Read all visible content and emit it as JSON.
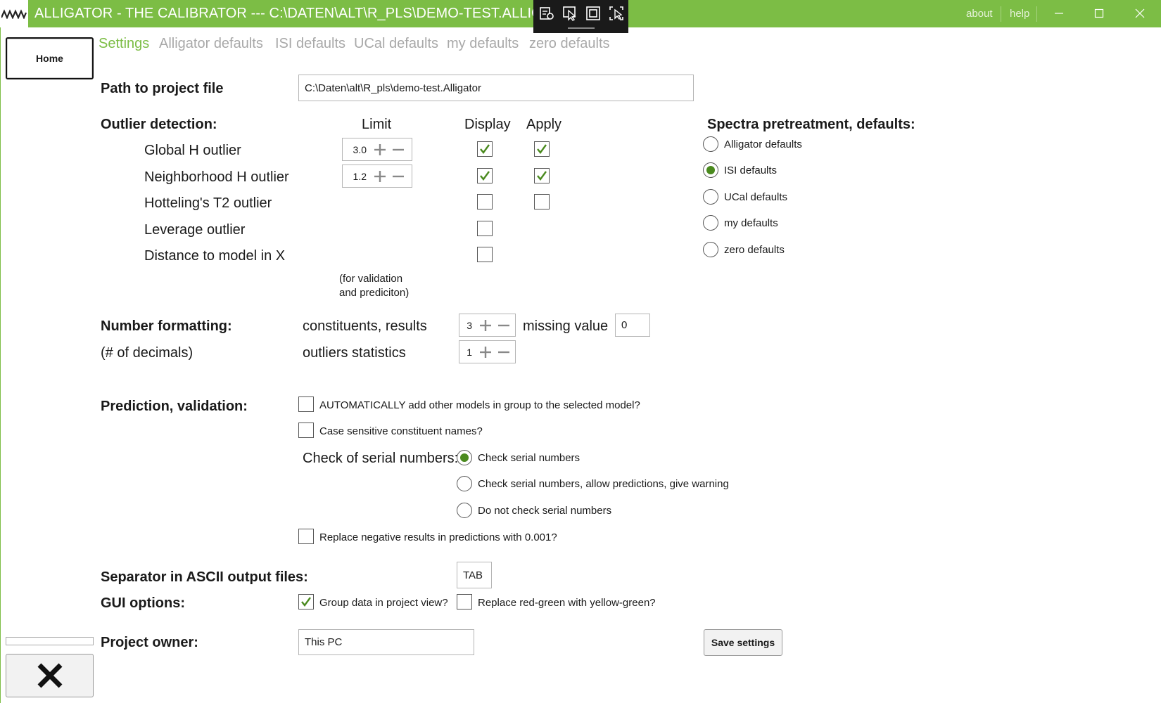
{
  "window": {
    "title": "ALLIGATOR - THE CALIBRATOR --- C:\\DATEN\\ALT\\R_PLS\\DEMO-TEST.ALLIGATOR",
    "about": "about",
    "help": "help",
    "accent": "#7cbd45"
  },
  "nav": {
    "home": "Home",
    "tabs": [
      "Settings",
      "Alligator defaults",
      "ISI defaults",
      "UCal defaults",
      "my defaults",
      "zero defaults"
    ],
    "active_tab": "Settings"
  },
  "project": {
    "path_label": "Path to project file",
    "path_value": "C:\\Daten\\alt\\R_pls\\demo-test.Alligator"
  },
  "outliers": {
    "label": "Outlier detection:",
    "col_limit": "Limit",
    "col_display": "Display",
    "col_apply": "Apply",
    "rows": [
      {
        "name": "Global H outlier",
        "limit": "3.0",
        "display": true,
        "apply": true
      },
      {
        "name": "Neighborhood H outlier",
        "limit": "1.2",
        "display": true,
        "apply": true
      },
      {
        "name": "Hotteling's T2 outlier",
        "display": false,
        "apply": false
      },
      {
        "name": "Leverage outlier",
        "display": false
      },
      {
        "name": "Distance to model in X",
        "display": false
      }
    ],
    "note_line1": "(for validation",
    "note_line2": "and prediciton)"
  },
  "pretreatment": {
    "label": "Spectra pretreatment, defaults:",
    "options": [
      "Alligator defaults",
      "ISI defaults",
      "UCal defaults",
      "my defaults",
      "zero defaults"
    ],
    "selected": "ISI defaults"
  },
  "number_formatting": {
    "label": "Number formatting:",
    "sublabel": "(# of decimals)",
    "constituents_label": "constituents, results",
    "constituents_value": "3",
    "missing_label": "missing value",
    "missing_value": "0",
    "outliers_label": "outliers statistics",
    "outliers_value": "1"
  },
  "prediction": {
    "label": "Prediction, validation:",
    "auto_add": {
      "label": "AUTOMATICALLY add other models in group to the selected model?",
      "checked": false
    },
    "case_sensitive": {
      "label": "Case sensitive constituent names?",
      "checked": false
    },
    "serial_label": "Check of serial numbers:",
    "serial_options": [
      "Check serial numbers",
      "Check serial numbers, allow predictions, give warning",
      "Do not check serial numbers"
    ],
    "serial_selected": "Check serial numbers",
    "replace_negative": {
      "label": "Replace negative results in predictions with 0.001?",
      "checked": false
    }
  },
  "separator": {
    "label": "Separator in ASCII output files:",
    "value": "TAB"
  },
  "gui": {
    "label": "GUI options:",
    "group_data": {
      "label": "Group data in project view?",
      "checked": true
    },
    "red_green": {
      "label": "Replace red-green with yellow-green?",
      "checked": false
    }
  },
  "owner": {
    "label": "Project owner:",
    "value": "This PC"
  },
  "save_button": "Save settings"
}
